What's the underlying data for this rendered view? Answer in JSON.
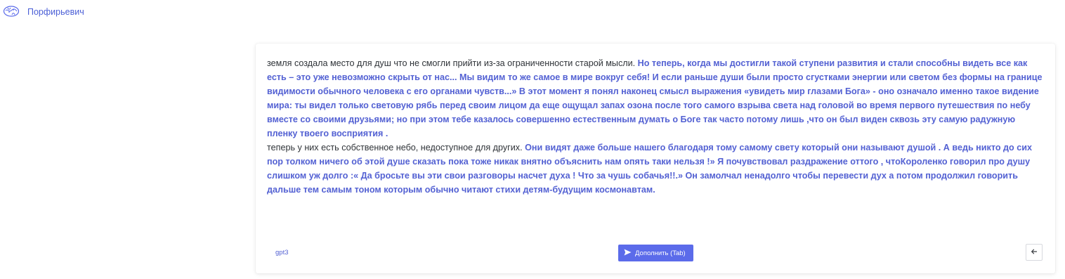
{
  "app": {
    "title": "Порфирьевич",
    "logo_icon": "brain-icon",
    "accent_color": "#5361d3"
  },
  "editor": {
    "paragraphs": [
      {
        "prompt": "земля создала место для душ что не смогли прийти из-за ограниченности старой мысли.",
        "generated": " Но теперь, когда мы достигли такой ступени развития и стали способны видеть все как есть – это уже невозможно скрыть от нас... Мы видим то же самое в мире вокруг себя! И если раньше души были просто сгустками энергии или светом без формы на границе видимости обычного человека с его органами чувств...» В этот момент я понял наконец смысл выражения «увидеть мир глазами Бога» - оно означало именно такое видение мира: ты видел только световую рябь перед своим лицом да еще ощущал запах озона после того самого взрыва света над головой во время первого путешествия по небу вместе со своими друзьями; но при этом тебе казалось совершенно естественным думать о Боге так часто потому лишь ,что он был виден сквозь эту самую радужную пленку твоего восприятия ."
      },
      {
        "prompt": "теперь у них есть собственное небо, недоступное для других.",
        "generated": " Они видят даже больше нашего благодаря тому самому свету который они называют душой . А ведь никто до сих пор толком ничего об этой душе сказать пока тоже никак внятно объяснить нам опять таки нельзя !» Я почувствовал раздражение оттого , чтоКороленко говорил про душу слишком уж долго :« Да бросьте вы эти свои разговоры насчет духа ! Что за чушь собачья!!.» Он замолчал ненадолго чтобы перевести дух а потом продолжил говорить дальше тем самым тоном которым обычно читают стихи детям-будущим космонавтам."
      }
    ]
  },
  "footer": {
    "model": "gpt3",
    "complete_label": "Дополнить (Tab)",
    "complete_icon": "send-icon",
    "back_icon": "arrow-left-icon"
  }
}
